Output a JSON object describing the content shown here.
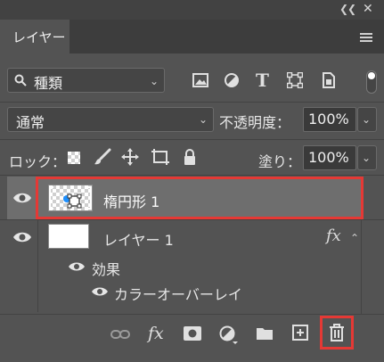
{
  "window": {
    "collapse_icon": "double-chevron-left-icon",
    "close_icon": "close-icon"
  },
  "tabs": {
    "active_label": "レイヤー",
    "menu_icon": "hamburger-menu-icon"
  },
  "filter": {
    "type_label": "種類",
    "icons": [
      "image-filter-icon",
      "adjustment-filter-icon",
      "type-filter-icon",
      "shape-filter-icon",
      "smart-object-filter-icon"
    ]
  },
  "blend": {
    "mode": "通常",
    "opacity_label": "不透明度：",
    "opacity_value": "100%"
  },
  "lock": {
    "label": "ロック：",
    "fill_label": "塗り：",
    "fill_value": "100%"
  },
  "layers": [
    {
      "name": "楕円形 1",
      "selected": true,
      "kind": "shape"
    },
    {
      "name": "レイヤー 1",
      "selected": false,
      "kind": "pixel",
      "fx": "fx",
      "effects_label": "効果",
      "effects": [
        "カラーオーバーレイ"
      ]
    }
  ],
  "footer": {
    "icons": [
      "link-layers-icon",
      "add-style-icon",
      "add-mask-icon",
      "new-adjustment-icon",
      "new-group-icon",
      "new-layer-icon",
      "delete-layer-icon"
    ],
    "fx_label": "fx"
  },
  "colors": {
    "highlight": "#e53935",
    "selected_row": "#6e6e6e",
    "panel": "#535353"
  }
}
